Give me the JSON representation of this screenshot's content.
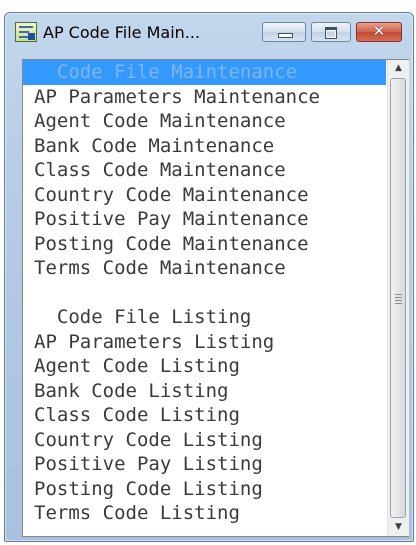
{
  "window": {
    "title": "AP Code File Main...",
    "colors": {
      "selection": "#3399ff",
      "close_button": "#c75037",
      "text": "#3a3a3a"
    },
    "icons": {
      "app": "app-form-icon",
      "minimize": "minimize-icon",
      "maximize": "maximize-icon",
      "close": "close-icon"
    },
    "close_glyph": "✕"
  },
  "list": {
    "selected_index": 0,
    "items": [
      "  Code File Maintenance",
      "AP Parameters Maintenance",
      "Agent Code Maintenance",
      "Bank Code Maintenance",
      "Class Code Maintenance",
      "Country Code Maintenance",
      "Positive Pay Maintenance",
      "Posting Code Maintenance",
      "Terms Code Maintenance",
      "",
      "  Code File Listing",
      "AP Parameters Listing",
      "Agent Code Listing",
      "Bank Code Listing",
      "Class Code Listing",
      "Country Code Listing",
      "Positive Pay Listing",
      "Posting Code Listing",
      "Terms Code Listing"
    ]
  },
  "scrollbar": {
    "up_glyph": "▲",
    "down_glyph": "▼"
  }
}
